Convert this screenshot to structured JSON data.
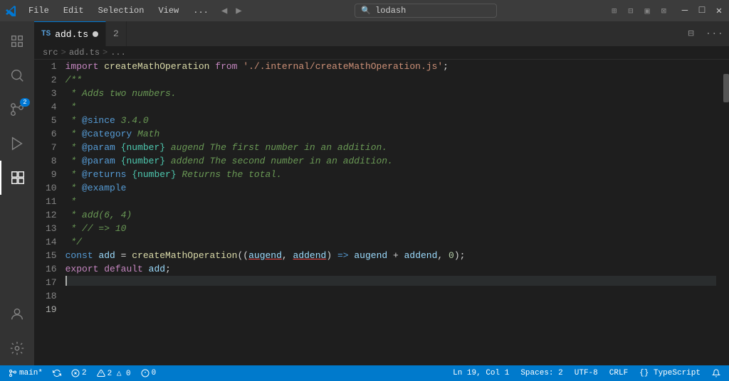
{
  "titlebar": {
    "menus": [
      "File",
      "Edit",
      "Selection",
      "View",
      "..."
    ],
    "search_placeholder": "lodash",
    "search_text": "lodash",
    "layout_icons": [
      "⊞",
      "⊟",
      "▣",
      "⊠"
    ],
    "controls": [
      "—",
      "□",
      "✕"
    ]
  },
  "tabs": [
    {
      "id": "add-ts",
      "ts_badge": "TS",
      "name": "add.ts",
      "dirty": true,
      "active": true
    },
    {
      "id": "tab2",
      "ts_badge": "",
      "name": "2",
      "dirty": false,
      "active": false
    }
  ],
  "breadcrumb": {
    "parts": [
      "src",
      ">",
      "add.ts",
      ">",
      "..."
    ]
  },
  "activity": {
    "items": [
      {
        "id": "explorer",
        "icon": "files",
        "active": false
      },
      {
        "id": "search",
        "icon": "search",
        "active": false
      },
      {
        "id": "source-control",
        "icon": "git",
        "active": false,
        "badge": "2"
      },
      {
        "id": "run",
        "icon": "play",
        "active": false
      },
      {
        "id": "extensions",
        "icon": "extensions",
        "active": true
      }
    ],
    "bottom": [
      {
        "id": "account",
        "icon": "account"
      },
      {
        "id": "settings",
        "icon": "settings"
      }
    ]
  },
  "code": {
    "lines": [
      {
        "num": 1,
        "tokens": [
          {
            "t": "kw-import",
            "v": "import"
          },
          {
            "t": "plain",
            "v": " "
          },
          {
            "t": "fn-name",
            "v": "createMathOperation"
          },
          {
            "t": "plain",
            "v": " "
          },
          {
            "t": "kw-from",
            "v": "from"
          },
          {
            "t": "plain",
            "v": " "
          },
          {
            "t": "str",
            "v": "'./.internal/createMathOperation.js'"
          },
          {
            "t": "plain",
            "v": ";"
          }
        ]
      },
      {
        "num": 2,
        "tokens": []
      },
      {
        "num": 3,
        "tokens": [
          {
            "t": "comment",
            "v": "/**"
          }
        ]
      },
      {
        "num": 4,
        "tokens": [
          {
            "t": "comment",
            "v": " * Adds two numbers."
          }
        ]
      },
      {
        "num": 5,
        "tokens": [
          {
            "t": "comment",
            "v": " *"
          }
        ]
      },
      {
        "num": 6,
        "tokens": [
          {
            "t": "comment",
            "v": " * "
          },
          {
            "t": "jsdoc-tag",
            "v": "@since"
          },
          {
            "t": "comment",
            "v": " 3.4.0"
          }
        ]
      },
      {
        "num": 7,
        "tokens": [
          {
            "t": "comment",
            "v": " * "
          },
          {
            "t": "jsdoc-tag",
            "v": "@category"
          },
          {
            "t": "comment",
            "v": " Math"
          }
        ]
      },
      {
        "num": 8,
        "tokens": [
          {
            "t": "comment",
            "v": " * "
          },
          {
            "t": "jsdoc-tag",
            "v": "@param"
          },
          {
            "t": "comment",
            "v": " "
          },
          {
            "t": "jsdoc-type",
            "v": "{number}"
          },
          {
            "t": "comment",
            "v": " augend The first number in an addition."
          }
        ]
      },
      {
        "num": 9,
        "tokens": [
          {
            "t": "comment",
            "v": " * "
          },
          {
            "t": "jsdoc-tag",
            "v": "@param"
          },
          {
            "t": "comment",
            "v": " "
          },
          {
            "t": "jsdoc-type",
            "v": "{number}"
          },
          {
            "t": "comment",
            "v": " addend The second number in an addition."
          }
        ]
      },
      {
        "num": 10,
        "tokens": [
          {
            "t": "comment",
            "v": " * "
          },
          {
            "t": "jsdoc-tag",
            "v": "@returns"
          },
          {
            "t": "comment",
            "v": " "
          },
          {
            "t": "jsdoc-type",
            "v": "{number}"
          },
          {
            "t": "comment",
            "v": " Returns the total."
          }
        ]
      },
      {
        "num": 11,
        "tokens": [
          {
            "t": "comment",
            "v": " * "
          },
          {
            "t": "jsdoc-tag",
            "v": "@example"
          }
        ]
      },
      {
        "num": 12,
        "tokens": [
          {
            "t": "comment",
            "v": " *"
          }
        ]
      },
      {
        "num": 13,
        "tokens": [
          {
            "t": "comment",
            "v": " * add(6, 4)"
          }
        ]
      },
      {
        "num": 14,
        "tokens": [
          {
            "t": "comment",
            "v": " * // => 10"
          }
        ]
      },
      {
        "num": 15,
        "tokens": [
          {
            "t": "comment",
            "v": " */"
          }
        ]
      },
      {
        "num": 16,
        "tokens": [
          {
            "t": "kw-const",
            "v": "const"
          },
          {
            "t": "plain",
            "v": " "
          },
          {
            "t": "var-name",
            "v": "add"
          },
          {
            "t": "plain",
            "v": " = "
          },
          {
            "t": "fn-name",
            "v": "createMathOperation"
          },
          {
            "t": "plain",
            "v": "(("
          },
          {
            "t": "param-underline",
            "v": "augend"
          },
          {
            "t": "plain",
            "v": ", "
          },
          {
            "t": "param-underline",
            "v": "addend"
          },
          {
            "t": "plain",
            "v": ")"
          },
          {
            "t": "plain",
            "v": " "
          },
          {
            "t": "arrow",
            "v": "=>"
          },
          {
            "t": "plain",
            "v": " "
          },
          {
            "t": "var-name",
            "v": "augend"
          },
          {
            "t": "plain",
            "v": " + "
          },
          {
            "t": "var-name",
            "v": "addend"
          },
          {
            "t": "plain",
            "v": ", "
          },
          {
            "t": "num",
            "v": "0"
          },
          {
            "t": "plain",
            "v": ");"
          }
        ]
      },
      {
        "num": 17,
        "tokens": []
      },
      {
        "num": 18,
        "tokens": [
          {
            "t": "kw-export",
            "v": "export"
          },
          {
            "t": "plain",
            "v": " "
          },
          {
            "t": "kw-default",
            "v": "default"
          },
          {
            "t": "plain",
            "v": " "
          },
          {
            "t": "var-name",
            "v": "add"
          },
          {
            "t": "plain",
            "v": ";"
          }
        ]
      },
      {
        "num": 19,
        "tokens": [],
        "cursor": true
      }
    ]
  },
  "statusbar": {
    "left": [
      {
        "id": "branch",
        "icon": "git-branch",
        "text": "main*"
      },
      {
        "id": "sync",
        "icon": "sync",
        "text": ""
      },
      {
        "id": "errors",
        "icon": "error",
        "text": "2"
      },
      {
        "id": "warnings",
        "icon": "warning",
        "text": "2  △  0"
      },
      {
        "id": "info",
        "icon": "info",
        "text": "⓪  0"
      }
    ],
    "right": [
      {
        "id": "cursor-pos",
        "text": "Ln 19, Col 1"
      },
      {
        "id": "spaces",
        "text": "Spaces: 2"
      },
      {
        "id": "encoding",
        "text": "UTF-8"
      },
      {
        "id": "line-ending",
        "text": "CRLF"
      },
      {
        "id": "language",
        "text": "{} TypeScript"
      },
      {
        "id": "notifications",
        "icon": "bell",
        "text": ""
      }
    ]
  }
}
